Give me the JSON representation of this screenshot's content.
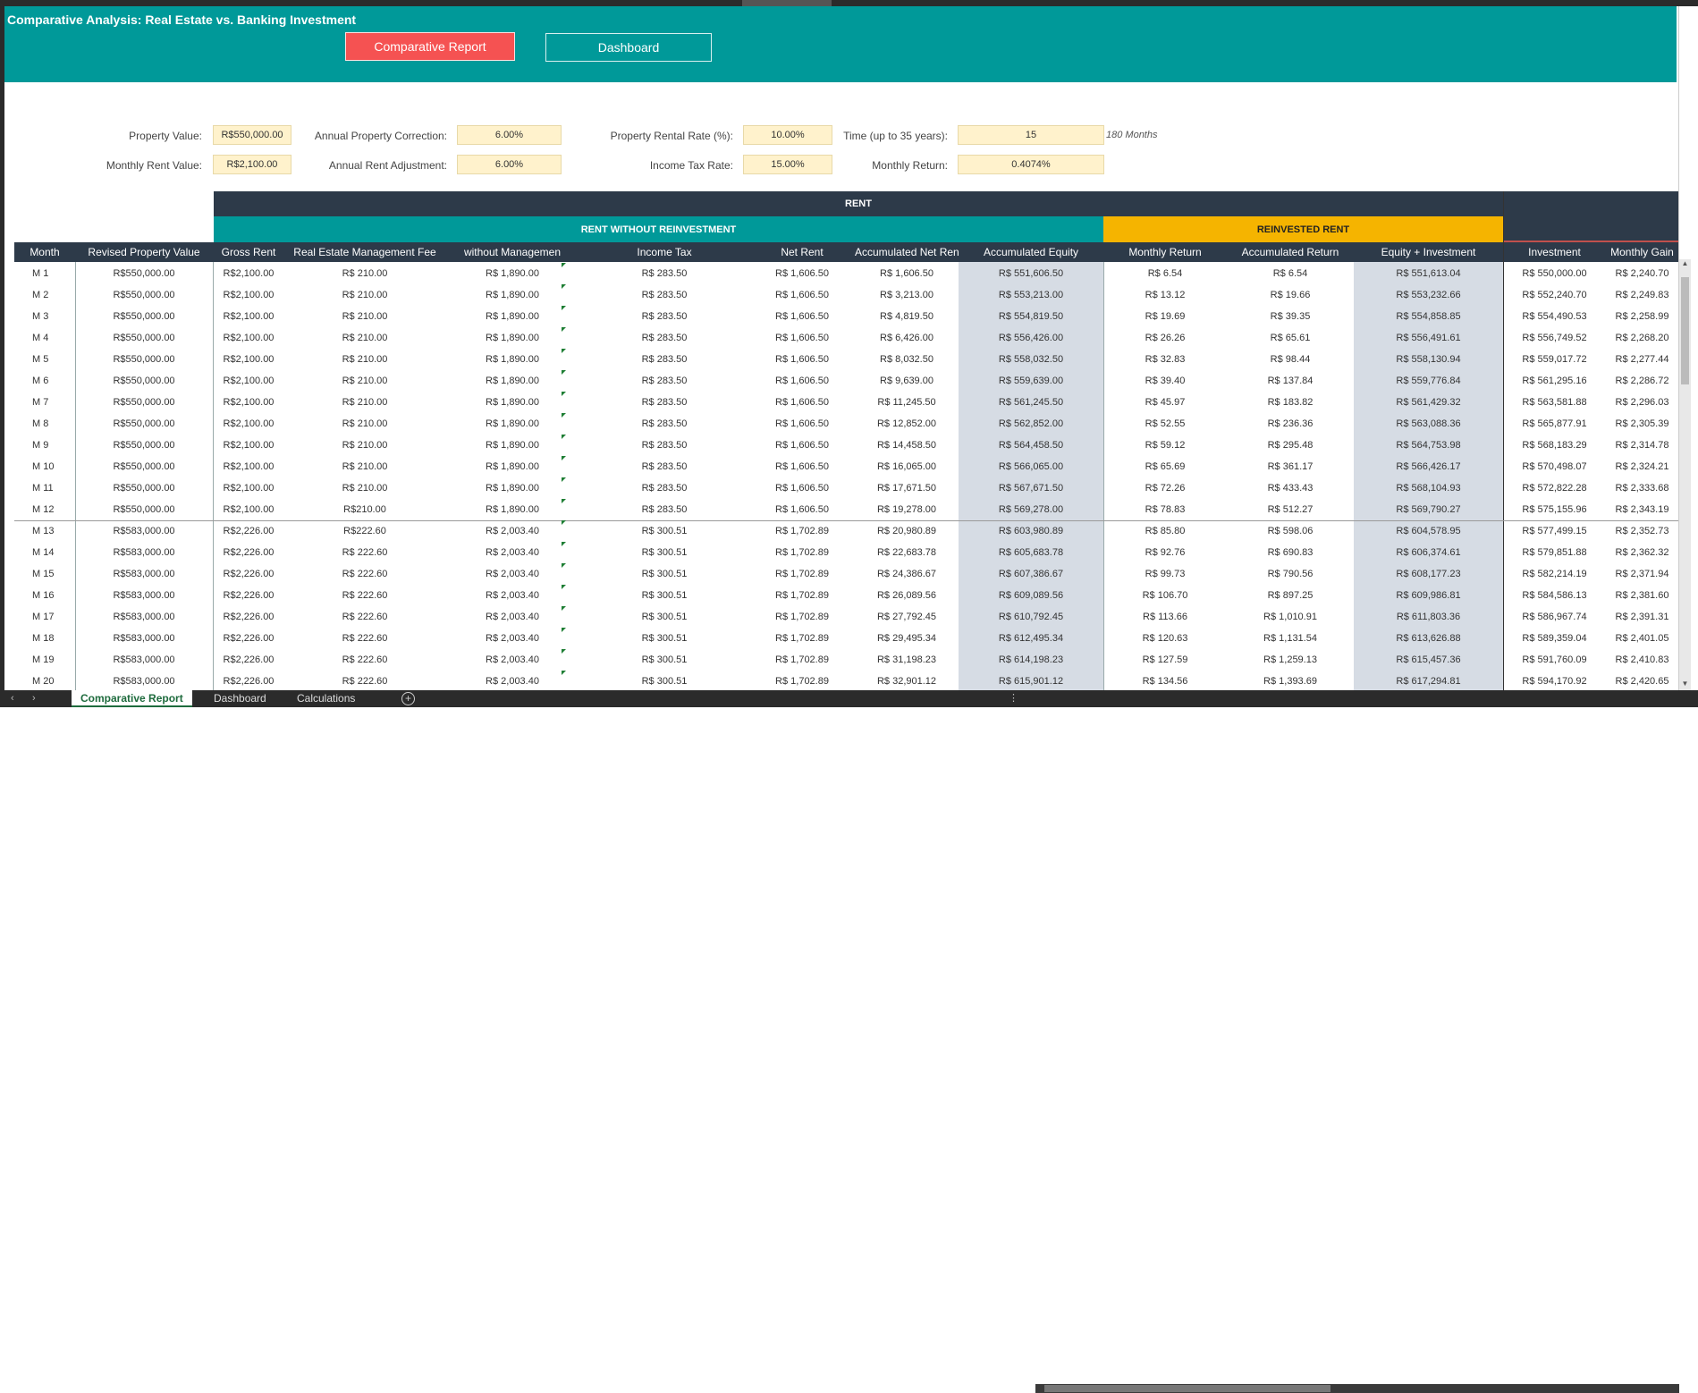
{
  "title": "Comparative Analysis: Real Estate vs. Banking Investment",
  "buttons": {
    "report": "Comparative Report",
    "dashboard": "Dashboard"
  },
  "params": {
    "property_value_label": "Property Value:",
    "property_value": "R$550,000.00",
    "monthly_rent_label": "Monthly Rent Value:",
    "monthly_rent": "R$2,100.00",
    "annual_correction_label": "Annual Property Correction:",
    "annual_correction": "6.00%",
    "annual_rent_adj_label": "Annual Rent Adjustment:",
    "annual_rent_adj": "6.00%",
    "rental_rate_label": "Property Rental Rate (%):",
    "rental_rate": "10.00%",
    "income_tax_label": "Income Tax Rate:",
    "income_tax": "15.00%",
    "time_label": "Time (up to 35 years):",
    "time": "15",
    "time_note": "180 Months",
    "monthly_return_label": "Monthly Return:",
    "monthly_return": "0.4074%"
  },
  "bands": {
    "rent": "RENT",
    "no_reinvest": "RENT WITHOUT REINVESTMENT",
    "reinvest": "REINVESTED RENT"
  },
  "headers": [
    "Month",
    "Revised Property Value",
    "Gross Rent",
    "Real Estate Management Fee",
    "without Managemen",
    "Income Tax",
    "Net Rent",
    "Accumulated Net Rent",
    "Accumulated Equity",
    "Monthly Return",
    "Accumulated Return",
    "Equity + Investment",
    "Investment",
    "Monthly Gain"
  ],
  "rows": [
    [
      "M  1",
      "R$550,000.00",
      "R$2,100.00",
      "R$ 210.00",
      "R$ 1,890.00",
      "R$ 283.50",
      "R$ 1,606.50",
      "R$ 1,606.50",
      "R$ 551,606.50",
      "R$ 6.54",
      "R$ 6.54",
      "R$ 551,613.04",
      "R$ 550,000.00",
      "R$ 2,240.70"
    ],
    [
      "M  2",
      "R$550,000.00",
      "R$2,100.00",
      "R$ 210.00",
      "R$ 1,890.00",
      "R$ 283.50",
      "R$ 1,606.50",
      "R$ 3,213.00",
      "R$ 553,213.00",
      "R$ 13.12",
      "R$ 19.66",
      "R$ 553,232.66",
      "R$ 552,240.70",
      "R$ 2,249.83"
    ],
    [
      "M  3",
      "R$550,000.00",
      "R$2,100.00",
      "R$ 210.00",
      "R$ 1,890.00",
      "R$ 283.50",
      "R$ 1,606.50",
      "R$ 4,819.50",
      "R$ 554,819.50",
      "R$ 19.69",
      "R$ 39.35",
      "R$ 554,858.85",
      "R$ 554,490.53",
      "R$ 2,258.99"
    ],
    [
      "M  4",
      "R$550,000.00",
      "R$2,100.00",
      "R$ 210.00",
      "R$ 1,890.00",
      "R$ 283.50",
      "R$ 1,606.50",
      "R$ 6,426.00",
      "R$ 556,426.00",
      "R$ 26.26",
      "R$ 65.61",
      "R$ 556,491.61",
      "R$ 556,749.52",
      "R$ 2,268.20"
    ],
    [
      "M  5",
      "R$550,000.00",
      "R$2,100.00",
      "R$ 210.00",
      "R$ 1,890.00",
      "R$ 283.50",
      "R$ 1,606.50",
      "R$ 8,032.50",
      "R$ 558,032.50",
      "R$ 32.83",
      "R$ 98.44",
      "R$ 558,130.94",
      "R$ 559,017.72",
      "R$ 2,277.44"
    ],
    [
      "M  6",
      "R$550,000.00",
      "R$2,100.00",
      "R$ 210.00",
      "R$ 1,890.00",
      "R$ 283.50",
      "R$ 1,606.50",
      "R$ 9,639.00",
      "R$ 559,639.00",
      "R$ 39.40",
      "R$ 137.84",
      "R$ 559,776.84",
      "R$ 561,295.16",
      "R$ 2,286.72"
    ],
    [
      "M  7",
      "R$550,000.00",
      "R$2,100.00",
      "R$ 210.00",
      "R$ 1,890.00",
      "R$ 283.50",
      "R$ 1,606.50",
      "R$ 11,245.50",
      "R$ 561,245.50",
      "R$ 45.97",
      "R$ 183.82",
      "R$ 561,429.32",
      "R$ 563,581.88",
      "R$ 2,296.03"
    ],
    [
      "M  8",
      "R$550,000.00",
      "R$2,100.00",
      "R$ 210.00",
      "R$ 1,890.00",
      "R$ 283.50",
      "R$ 1,606.50",
      "R$ 12,852.00",
      "R$ 562,852.00",
      "R$ 52.55",
      "R$ 236.36",
      "R$ 563,088.36",
      "R$ 565,877.91",
      "R$ 2,305.39"
    ],
    [
      "M  9",
      "R$550,000.00",
      "R$2,100.00",
      "R$ 210.00",
      "R$ 1,890.00",
      "R$ 283.50",
      "R$ 1,606.50",
      "R$ 14,458.50",
      "R$ 564,458.50",
      "R$ 59.12",
      "R$ 295.48",
      "R$ 564,753.98",
      "R$ 568,183.29",
      "R$ 2,314.78"
    ],
    [
      "M  10",
      "R$550,000.00",
      "R$2,100.00",
      "R$ 210.00",
      "R$ 1,890.00",
      "R$ 283.50",
      "R$ 1,606.50",
      "R$ 16,065.00",
      "R$ 566,065.00",
      "R$ 65.69",
      "R$ 361.17",
      "R$ 566,426.17",
      "R$ 570,498.07",
      "R$ 2,324.21"
    ],
    [
      "M  11",
      "R$550,000.00",
      "R$2,100.00",
      "R$ 210.00",
      "R$ 1,890.00",
      "R$ 283.50",
      "R$ 1,606.50",
      "R$ 17,671.50",
      "R$ 567,671.50",
      "R$ 72.26",
      "R$ 433.43",
      "R$ 568,104.93",
      "R$ 572,822.28",
      "R$ 2,333.68"
    ],
    [
      "M  12",
      "R$550,000.00",
      "R$2,100.00",
      "R$210.00",
      "R$ 1,890.00",
      "R$ 283.50",
      "R$ 1,606.50",
      "R$ 19,278.00",
      "R$ 569,278.00",
      "R$ 78.83",
      "R$ 512.27",
      "R$ 569,790.27",
      "R$ 575,155.96",
      "R$ 2,343.19"
    ],
    [
      "M  13",
      "R$583,000.00",
      "R$2,226.00",
      "R$222.60",
      "R$ 2,003.40",
      "R$ 300.51",
      "R$ 1,702.89",
      "R$ 20,980.89",
      "R$ 603,980.89",
      "R$ 85.80",
      "R$ 598.06",
      "R$ 604,578.95",
      "R$ 577,499.15",
      "R$ 2,352.73"
    ],
    [
      "M  14",
      "R$583,000.00",
      "R$2,226.00",
      "R$ 222.60",
      "R$ 2,003.40",
      "R$ 300.51",
      "R$ 1,702.89",
      "R$ 22,683.78",
      "R$ 605,683.78",
      "R$ 92.76",
      "R$ 690.83",
      "R$ 606,374.61",
      "R$ 579,851.88",
      "R$ 2,362.32"
    ],
    [
      "M  15",
      "R$583,000.00",
      "R$2,226.00",
      "R$ 222.60",
      "R$ 2,003.40",
      "R$ 300.51",
      "R$ 1,702.89",
      "R$ 24,386.67",
      "R$ 607,386.67",
      "R$ 99.73",
      "R$ 790.56",
      "R$ 608,177.23",
      "R$ 582,214.19",
      "R$ 2,371.94"
    ],
    [
      "M  16",
      "R$583,000.00",
      "R$2,226.00",
      "R$ 222.60",
      "R$ 2,003.40",
      "R$ 300.51",
      "R$ 1,702.89",
      "R$ 26,089.56",
      "R$ 609,089.56",
      "R$ 106.70",
      "R$ 897.25",
      "R$ 609,986.81",
      "R$ 584,586.13",
      "R$ 2,381.60"
    ],
    [
      "M  17",
      "R$583,000.00",
      "R$2,226.00",
      "R$ 222.60",
      "R$ 2,003.40",
      "R$ 300.51",
      "R$ 1,702.89",
      "R$ 27,792.45",
      "R$ 610,792.45",
      "R$ 113.66",
      "R$ 1,010.91",
      "R$ 611,803.36",
      "R$ 586,967.74",
      "R$ 2,391.31"
    ],
    [
      "M  18",
      "R$583,000.00",
      "R$2,226.00",
      "R$ 222.60",
      "R$ 2,003.40",
      "R$ 300.51",
      "R$ 1,702.89",
      "R$ 29,495.34",
      "R$ 612,495.34",
      "R$ 120.63",
      "R$ 1,131.54",
      "R$ 613,626.88",
      "R$ 589,359.04",
      "R$ 2,401.05"
    ],
    [
      "M  19",
      "R$583,000.00",
      "R$2,226.00",
      "R$ 222.60",
      "R$ 2,003.40",
      "R$ 300.51",
      "R$ 1,702.89",
      "R$ 31,198.23",
      "R$ 614,198.23",
      "R$ 127.59",
      "R$ 1,259.13",
      "R$ 615,457.36",
      "R$ 591,760.09",
      "R$ 2,410.83"
    ],
    [
      "M  20",
      "R$583,000.00",
      "R$2,226.00",
      "R$ 222.60",
      "R$ 2,003.40",
      "R$ 300.51",
      "R$ 1,702.89",
      "R$ 32,901.12",
      "R$ 615,901.12",
      "R$ 134.56",
      "R$ 1,393.69",
      "R$ 617,294.81",
      "R$ 594,170.92",
      "R$ 2,420.65"
    ]
  ],
  "tabs": [
    "Comparative Report",
    "Dashboard",
    "Calculations"
  ],
  "nav": {
    "prev": "‹",
    "next": "›",
    "add": "+",
    "more": "⋮"
  },
  "colors": {
    "banner": "#009999",
    "red_button": "#f55252",
    "input": "#fff2cc",
    "header_dark": "#2d3a49",
    "reinvest": "#f5b400"
  }
}
